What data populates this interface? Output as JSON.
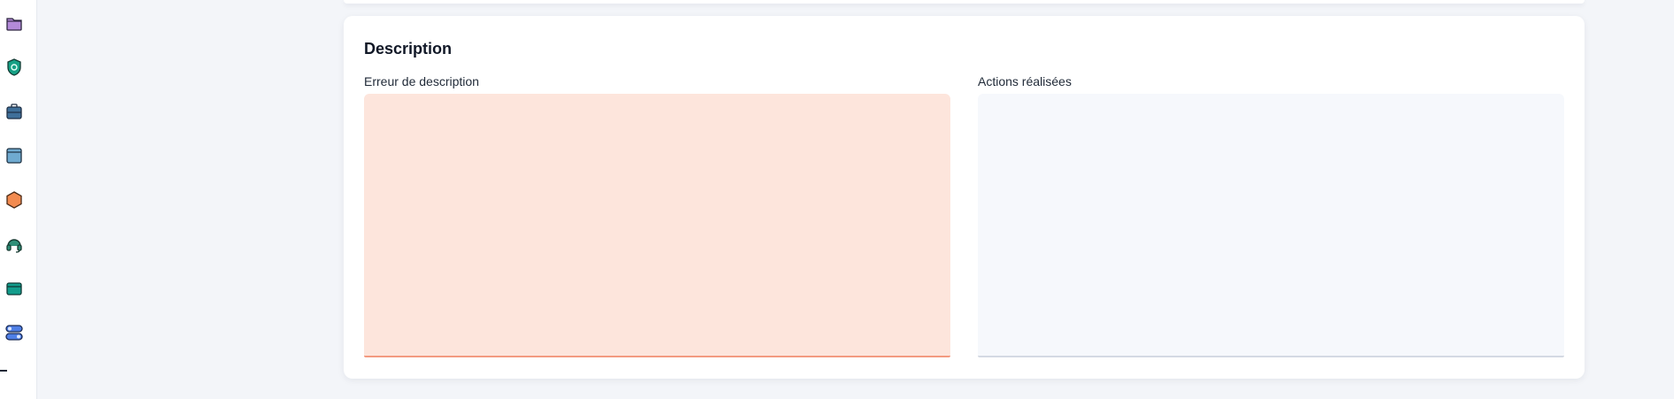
{
  "sidebar": {
    "icons": [
      {
        "name": "folder-icon",
        "color": "#b38ad9"
      },
      {
        "name": "shield-icon",
        "color": "#16a085"
      },
      {
        "name": "briefcase-icon",
        "color": "#3f6f99"
      },
      {
        "name": "window-icon",
        "color": "#6faad0"
      },
      {
        "name": "hexagon-icon",
        "color": "#f28b50"
      },
      {
        "name": "headset-icon",
        "color": "#2f8f78"
      },
      {
        "name": "card-icon",
        "color": "#129c8b"
      },
      {
        "name": "toggle-icon",
        "color": "#4f7fe6"
      }
    ]
  },
  "description_card": {
    "title": "Description",
    "error_field": {
      "label": "Erreur de description",
      "value": "",
      "bg_color": "#fde5dc",
      "border_color": "#f39a80"
    },
    "actions_field": {
      "label": "Actions réalisées",
      "value": "",
      "bg_color": "#f6f8fc"
    }
  }
}
